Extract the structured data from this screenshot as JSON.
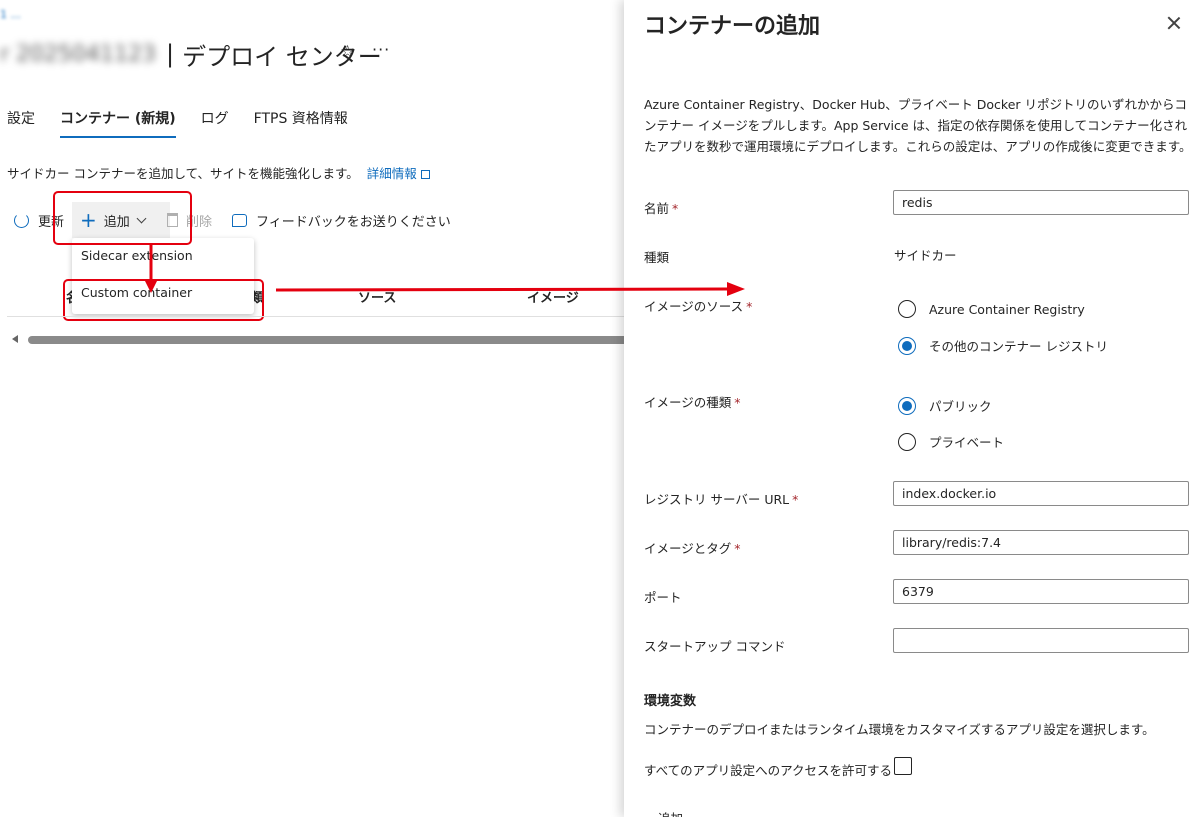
{
  "breadcrumb": "1 ...",
  "page": {
    "title_blurred": "r 2025041123",
    "title": "デプロイ センター",
    "separator": "|"
  },
  "tabs": [
    {
      "label": "設定",
      "active": false
    },
    {
      "label": "コンテナー (新規)",
      "active": true
    },
    {
      "label": "ログ",
      "active": false
    },
    {
      "label": "FTPS 資格情報",
      "active": false
    }
  ],
  "description": {
    "text": "サイドカー コンテナーを追加して、サイトを機能強化します。",
    "link": "詳細情報"
  },
  "toolbar": {
    "refresh": "更新",
    "add": "追加",
    "delete": "削除",
    "feedback": "フィードバックをお送りください"
  },
  "add_menu": {
    "items": [
      "Sidecar extension",
      "Custom container"
    ]
  },
  "table": {
    "columns": [
      "名",
      "種類",
      "ソース",
      "イメージ"
    ]
  },
  "panel": {
    "title": "コンテナーの追加",
    "description": "Azure Container Registry、Docker Hub、プライベート Docker リポジトリのいずれかからコンテナー イメージをプルします。App Service は、指定の依存関係を使用してコンテナー化されたアプリを数秒で運用環境にデプロイします。これらの設定は、アプリの作成後に変更できます。",
    "name": {
      "label": "名前",
      "value": "redis"
    },
    "kind": {
      "label": "種類",
      "value": "サイドカー"
    },
    "image_source": {
      "label": "イメージのソース",
      "options": [
        "Azure Container Registry",
        "その他のコンテナー レジストリ"
      ],
      "selected": 1
    },
    "image_type": {
      "label": "イメージの種類",
      "options": [
        "パブリック",
        "プライベート"
      ],
      "selected": 0
    },
    "registry_url": {
      "label": "レジストリ サーバー URL",
      "value": "index.docker.io"
    },
    "image_tag": {
      "label": "イメージとタグ",
      "value": "library/redis:7.4"
    },
    "port": {
      "label": "ポート",
      "value": "6379"
    },
    "startup": {
      "label": "スタートアップ コマンド",
      "value": ""
    },
    "env": {
      "title": "環境変数",
      "description": "コンテナーのデプロイまたはランタイム環境をカスタマイズするアプリ設定を選択します。",
      "allow_label": "すべてのアプリ設定へのアクセスを許可する",
      "add": "追加"
    }
  },
  "colors": {
    "accent": "#0f6cbd",
    "highlight": "#e4000f",
    "required": "#a4262c"
  }
}
